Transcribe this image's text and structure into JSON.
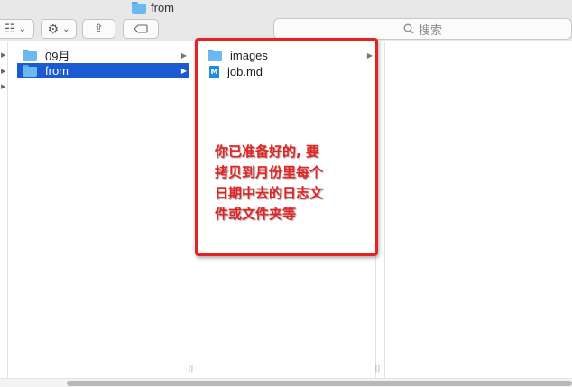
{
  "window": {
    "title": "from"
  },
  "toolbar": {
    "view_icon": "icon-grid-icon",
    "view_glyph": "☷",
    "chevron": "⌄",
    "gear_glyph": "⚙",
    "share_glyph": "⇪",
    "tag_glyph": "⬭"
  },
  "search": {
    "placeholder": "搜索",
    "icon": "search-icon",
    "glyph": "⌕"
  },
  "columns": {
    "col1": [
      {
        "name": "09月",
        "type": "folder",
        "has_children": true,
        "selected": false
      },
      {
        "name": "from",
        "type": "folder",
        "has_children": true,
        "selected": true
      }
    ],
    "col2": [
      {
        "name": "images",
        "type": "folder",
        "has_children": true,
        "selected": false
      },
      {
        "name": "job.md",
        "type": "markdown-file",
        "has_children": false,
        "selected": false
      }
    ]
  },
  "file_icons": {
    "markdown_letter": "M"
  },
  "chevron_right": "▶",
  "resize_handle": "||",
  "annotation": {
    "lines": [
      "你已准备好的, 要",
      "拷贝到月份里每个",
      "日期中去的日志文",
      "件或文件夹等"
    ],
    "color": "#e52222"
  },
  "colors": {
    "selection": "#1b5ad1",
    "folder": "#6cb8f0",
    "annotation": "#e52222"
  }
}
